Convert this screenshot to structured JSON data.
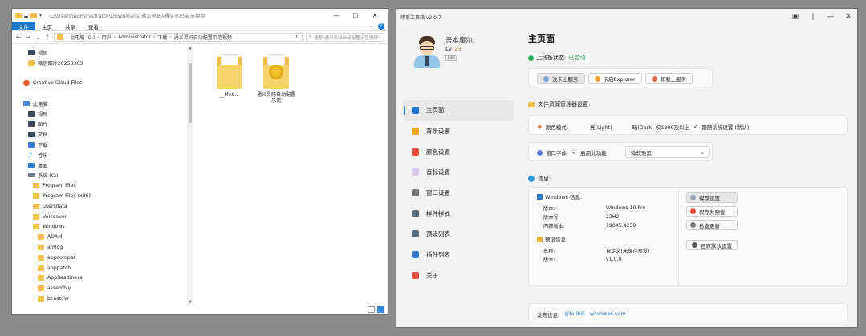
{
  "explorer": {
    "title_path": "C:\\Users\\Administrator\\Downloads\\通义灵码\\通义灵码演示视频",
    "ribbon_tabs": [
      "文件",
      "主页",
      "共享",
      "查看"
    ],
    "address": {
      "segments": [
        "此电脑 (C:)",
        "用户",
        "Administrator",
        "下载",
        "通义灵码自动配置示范视频"
      ],
      "search_placeholder": "搜索\"通义灵码自动配置示范视频\""
    },
    "nav_items": [
      {
        "label": "视频",
        "icon": "video-icon",
        "indent": 1,
        "pinned": true
      },
      {
        "label": "微信图片20250303",
        "icon": "folder-icon",
        "indent": 1,
        "pinned": true
      },
      {
        "label": "",
        "icon": "",
        "indent": 0,
        "pinned": false
      },
      {
        "label": "Creative Cloud Files",
        "icon": "creative-cloud-icon",
        "indent": 0,
        "pinned": false
      },
      {
        "label": "",
        "icon": "",
        "indent": 0,
        "pinned": false
      },
      {
        "label": "此电脑",
        "icon": "pc-icon",
        "indent": 0,
        "pinned": false
      },
      {
        "label": "视频",
        "icon": "video-icon",
        "indent": 1,
        "pinned": false
      },
      {
        "label": "图片",
        "icon": "pictures-icon",
        "indent": 1,
        "pinned": false
      },
      {
        "label": "文档",
        "icon": "documents-icon",
        "indent": 1,
        "pinned": false
      },
      {
        "label": "下载",
        "icon": "downloads-icon",
        "indent": 1,
        "pinned": false
      },
      {
        "label": "音乐",
        "icon": "music-icon",
        "indent": 1,
        "pinned": false
      },
      {
        "label": "桌面",
        "icon": "desktop-icon",
        "indent": 1,
        "pinned": false
      },
      {
        "label": "系统 (C:)",
        "icon": "drive-icon",
        "indent": 1,
        "pinned": false
      },
      {
        "label": "Program Files",
        "icon": "folder-icon",
        "indent": 2,
        "pinned": false
      },
      {
        "label": "Program Files (x86)",
        "icon": "folder-icon",
        "indent": 2,
        "pinned": false
      },
      {
        "label": "usersdata",
        "icon": "folder-icon",
        "indent": 2,
        "pinned": false
      },
      {
        "label": "Voiceover",
        "icon": "folder-icon",
        "indent": 2,
        "pinned": false
      },
      {
        "label": "Windows",
        "icon": "folder-icon",
        "indent": 2,
        "pinned": false
      },
      {
        "label": "ADAM",
        "icon": "folder-icon",
        "indent": 3,
        "pinned": false
      },
      {
        "label": "amlog",
        "icon": "folder-icon",
        "indent": 3,
        "pinned": false
      },
      {
        "label": "appcompat",
        "icon": "folder-icon",
        "indent": 3,
        "pinned": false
      },
      {
        "label": "apppatch",
        "icon": "folder-icon",
        "indent": 3,
        "pinned": false
      },
      {
        "label": "AppReadiness",
        "icon": "folder-icon",
        "indent": 3,
        "pinned": false
      },
      {
        "label": "assembly",
        "icon": "folder-icon",
        "indent": 3,
        "pinned": false
      },
      {
        "label": "bcastdvr",
        "icon": "folder-icon",
        "indent": 3,
        "pinned": false
      },
      {
        "label": "Boot",
        "icon": "folder-icon",
        "indent": 3,
        "pinned": false
      }
    ],
    "files": [
      {
        "name": "__MAC...",
        "type": "folder"
      },
      {
        "name": "通义灵码自动配置示范",
        "type": "folder-media"
      }
    ]
  },
  "tool": {
    "title": "萌系工具箱 v2.0.7",
    "profile": {
      "name": "吾本魔尔",
      "line2_prefix": "Lv",
      "level": "23",
      "badge": "Lab"
    },
    "nav": [
      {
        "label": "主页面",
        "icon": "home-icon",
        "color": "#1f78d1",
        "active": true
      },
      {
        "label": "背景设置",
        "icon": "background-icon",
        "color": "#f5a623",
        "active": false
      },
      {
        "label": "颜色设置",
        "icon": "color-icon",
        "color": "#e94e3c",
        "active": false
      },
      {
        "label": "音标设置",
        "icon": "sound-icon",
        "color": "#d7c6e8",
        "active": false
      },
      {
        "label": "窗口设置",
        "icon": "window-icon",
        "color": "#777777",
        "active": false
      },
      {
        "label": "样件样式",
        "icon": "style-icon",
        "color": "#5a6b7c",
        "active": false
      },
      {
        "label": "预设列表",
        "icon": "preset-list-icon",
        "color": "#5a6b7c",
        "active": false
      },
      {
        "label": "插件列表",
        "icon": "plugin-list-icon",
        "color": "#2f7cd3",
        "active": false
      },
      {
        "label": "关于",
        "icon": "info-icon",
        "color": "#e94e3c",
        "active": false
      }
    ],
    "main": {
      "title": "主页面",
      "status_label": "上线备状态:",
      "status_value": "已启动",
      "service_buttons": [
        {
          "label": "注卡上服务",
          "icon": "gear-icon",
          "color": "#7aa6d6",
          "primary": true
        },
        {
          "label": "卡启Explorer",
          "icon": "refresh-icon",
          "color": "#f0a030",
          "primary": false
        },
        {
          "label": "卸载上服务",
          "icon": "uninstall-icon",
          "color": "#e07050",
          "primary": false
        }
      ],
      "file_section": "文件资源管理器设置:",
      "theme": {
        "label": "颜色模式:",
        "options": [
          "亮(Light)",
          "暗(Dark) 仅1809及以上",
          "跟随系统设置 (默认)"
        ],
        "checked_index": 2
      },
      "font": {
        "label": "窗口字体:",
        "enable_label": "启用此功能",
        "selected": "微软雅黑"
      },
      "info_section": "信息:",
      "windows_info": {
        "title": "Windows 信息:",
        "rows": [
          {
            "k": "版本:",
            "v": "Windows 10 Pro"
          },
          {
            "k": "版本号:",
            "v": "22H2"
          },
          {
            "k": "内部版本:",
            "v": "19045.4239"
          }
        ]
      },
      "config_info": {
        "title": "预设信息:",
        "rows": [
          {
            "k": "名称:",
            "v": "自定义(未保存预设)"
          },
          {
            "k": "版本:",
            "v": "v1.0.0"
          }
        ]
      },
      "actions": [
        {
          "label": "保存设置",
          "icon": "save-icon",
          "color": "#9aa5b1"
        },
        {
          "label": "保存为预设",
          "icon": "preset-icon",
          "color": "#e94e3c"
        },
        {
          "label": "检查更新",
          "icon": "update-icon",
          "color": "#777777"
        },
        {
          "label": "还原默认设置",
          "icon": "restore-icon",
          "color": "#555555"
        }
      ],
      "footer": {
        "label": "发布信息:",
        "link1": "@bilibili",
        "link2": "winmoes.com"
      }
    }
  }
}
